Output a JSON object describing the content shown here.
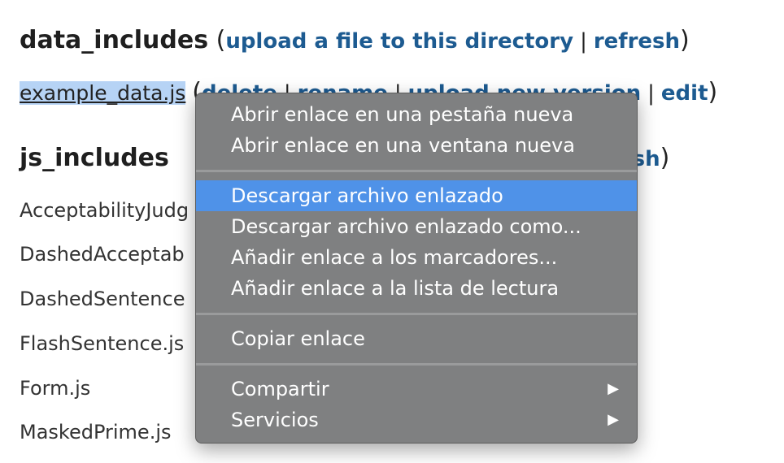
{
  "data_includes": {
    "title": "data_includes",
    "open_paren": "(",
    "close_paren": ")",
    "upload_link": "upload a file to this directory",
    "separator": "|",
    "refresh_link": "refresh"
  },
  "file_row": {
    "filename": "example_data.js",
    "open_paren": "(",
    "delete_link": "delete",
    "rename_link": "rename",
    "upload_new_version_link": "upload new version",
    "edit_link": "edit",
    "separator": "|",
    "close_paren": ")"
  },
  "js_includes": {
    "title": "js_includes",
    "refresh_partial": "esh",
    "close_paren": ")",
    "items": [
      "AcceptabilityJudg",
      "DashedAcceptab",
      "DashedSentence",
      "FlashSentence.js",
      "Form.js",
      "MaskedPrime.js"
    ]
  },
  "context_menu": {
    "open_new_tab": "Abrir enlace en una pestaña nueva",
    "open_new_window": "Abrir enlace en una ventana nueva",
    "download_linked_file": "Descargar archivo enlazado",
    "download_linked_file_as": "Descargar archivo enlazado como...",
    "add_to_bookmarks": "Añadir enlace a los marcadores...",
    "add_to_reading_list": "Añadir enlace a la lista de lectura",
    "copy_link": "Copiar enlace",
    "share": "Compartir",
    "services": "Servicios",
    "submenu_arrow": "▶"
  },
  "colors": {
    "link": "#1d5b91",
    "menu_bg": "#7f8081",
    "menu_selected": "#4f92e8",
    "selection_highlight": "#b6d3f5"
  }
}
